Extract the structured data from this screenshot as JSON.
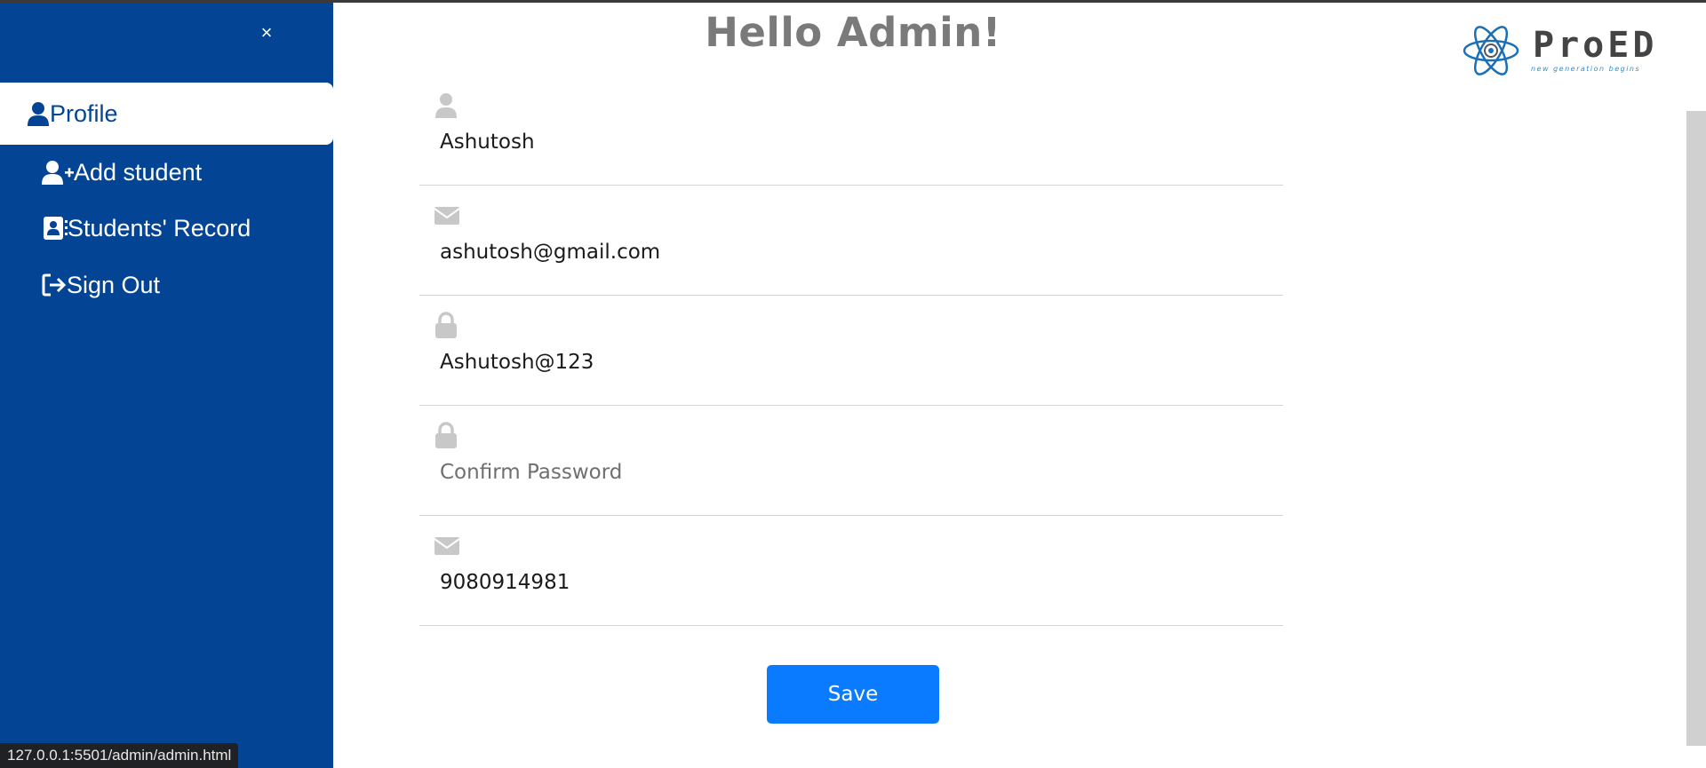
{
  "sidebar": {
    "close_icon": "×",
    "items": [
      {
        "label": "Profile",
        "icon": "user-icon",
        "active": true
      },
      {
        "label": "Add student",
        "icon": "user-plus-icon",
        "active": false
      },
      {
        "label": "Students' Record",
        "icon": "address-book-icon",
        "active": false
      },
      {
        "label": "Sign Out",
        "icon": "sign-out-icon",
        "active": false
      }
    ]
  },
  "header": {
    "title": "Hello Admin!",
    "logo_text": "ProED",
    "logo_tagline": "new generation begins"
  },
  "form": {
    "name": {
      "value": "Ashutosh",
      "icon": "user-icon"
    },
    "email": {
      "value": "ashutosh@gmail.com",
      "icon": "envelope-icon"
    },
    "password": {
      "value": "Ashutosh@123",
      "icon": "lock-icon"
    },
    "confirm_password": {
      "placeholder": "Confirm Password",
      "icon": "lock-icon"
    },
    "phone": {
      "value": "9080914981",
      "icon": "envelope-icon"
    },
    "save_label": "Save"
  },
  "statusbar": {
    "url": "127.0.0.1:5501/admin/admin.html"
  },
  "colors": {
    "sidebar": "#034594",
    "accent": "#0a7bff",
    "title": "#7a7a7a",
    "icon_gray": "#c8c8c8"
  }
}
